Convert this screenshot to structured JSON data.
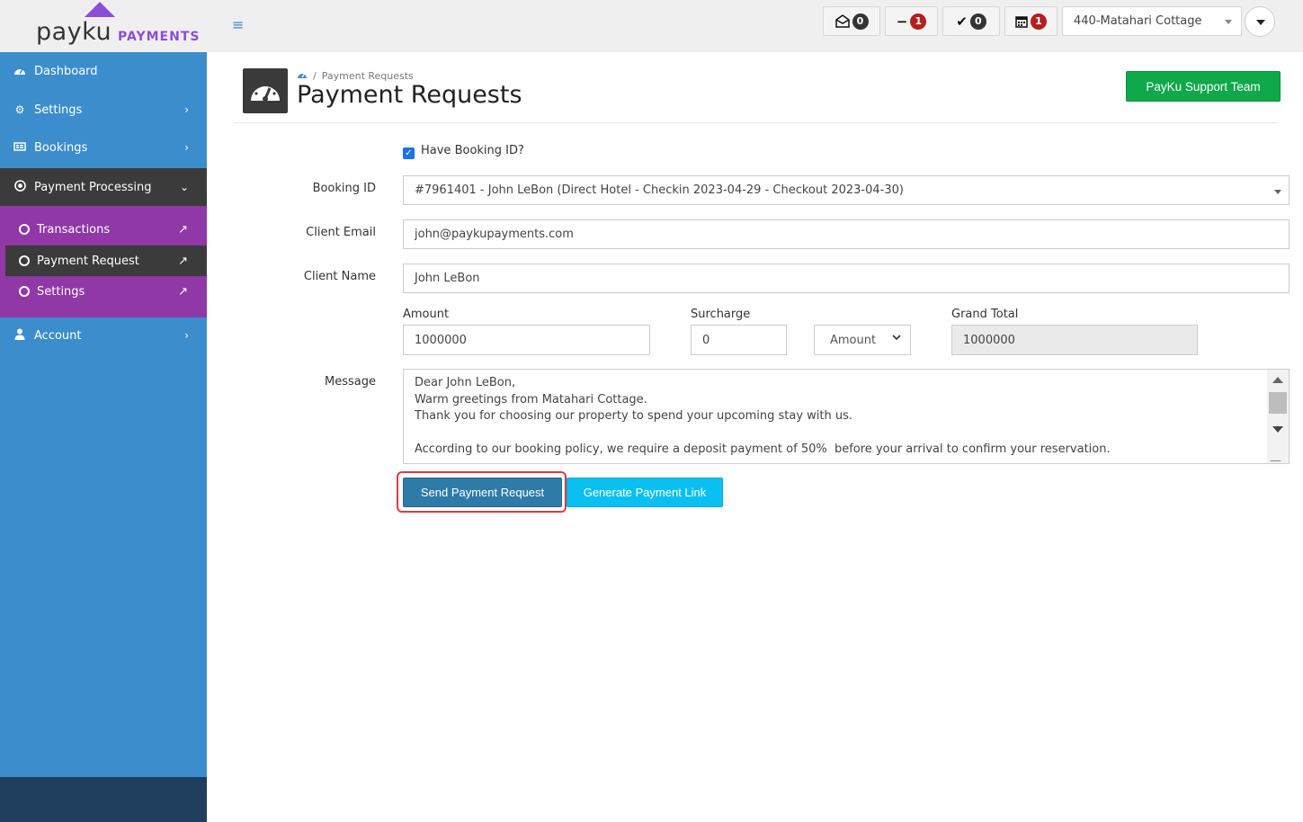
{
  "brand": {
    "name": "payku",
    "sub": "PAYMENTS",
    "accent": "#8a4fd8"
  },
  "header": {
    "menu_icon": "≡",
    "messages_count": "0",
    "minus_count": "1",
    "check_count": "0",
    "calendar_count": "1",
    "property": "440-Matahari Cottage"
  },
  "sidebar": {
    "items": {
      "dashboard": "Dashboard",
      "settings": "Settings",
      "bookings": "Bookings",
      "payment_processing": "Payment Processing",
      "account": "Account"
    },
    "sub_items": {
      "transactions": "Transactions",
      "payment_request": "Payment Request",
      "settings": "Settings"
    },
    "colors": {
      "background": "#3c8dcb",
      "submenu": "#8f38a6",
      "active": "#3b3b3b"
    }
  },
  "page": {
    "breadcrumb": "Payment Requests",
    "title": "Payment Requests",
    "support_button": "PayKu Support Team"
  },
  "form": {
    "have_booking_label": "Have Booking ID?",
    "booking_id_label": "Booking ID",
    "booking_id_value": "#7961401 - John LeBon (Direct Hotel - Checkin 2023-04-29 - Checkout 2023-04-30)",
    "client_email_label": "Client Email",
    "client_email_value": "john@paykupayments.com",
    "client_name_label": "Client Name",
    "client_name_value": "John LeBon",
    "amount_label": "Amount",
    "amount_value": "1000000",
    "surcharge_label": "Surcharge",
    "surcharge_value": "0",
    "surcharge_type": "Amount",
    "grand_total_label": "Grand Total",
    "grand_total_value": "1000000",
    "message_label": "Message",
    "message_lines": [
      "Dear John LeBon,",
      "Warm greetings from Matahari Cottage.",
      "Thank you for choosing our property to spend your upcoming stay with us.",
      "",
      "According to our booking policy, we require a deposit payment of 50%  before your arrival to confirm your reservation."
    ],
    "send_button": "Send Payment Request",
    "generate_button": "Generate Payment Link"
  }
}
